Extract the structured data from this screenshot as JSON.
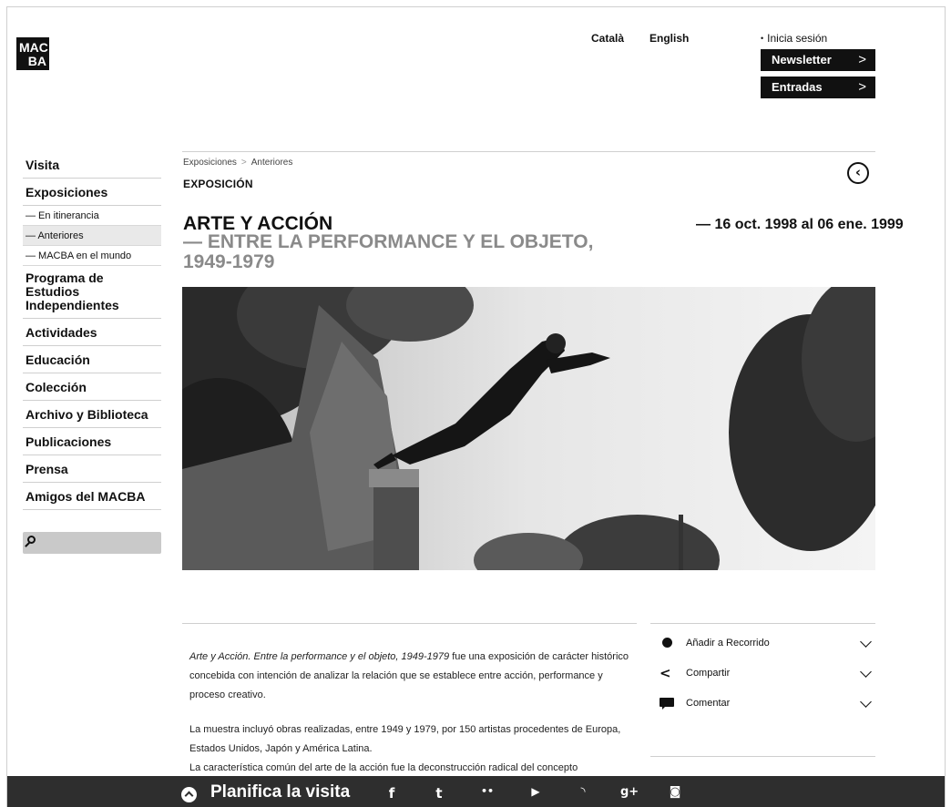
{
  "header": {
    "logo_line1": "MAC",
    "logo_line2": "BA",
    "lang_ca": "Català",
    "lang_en": "English",
    "login": "Inicia sesión",
    "newsletter": "Newsletter",
    "tickets": "Entradas",
    "arrow": ">"
  },
  "sidebar": {
    "visita": "Visita",
    "exposiciones": "Exposiciones",
    "sub": [
      "— En itinerancia",
      "— Anteriores",
      "— MACBA en el mundo"
    ],
    "programa": [
      "Programa de",
      "Estudios",
      "Independientes"
    ],
    "items": [
      "Actividades",
      "Educación",
      "Colección",
      "Archivo y Biblioteca",
      "Publicaciones",
      "Prensa",
      "Amigos del MACBA"
    ]
  },
  "breadcrumb": [
    "Exposiciones",
    "Anteriores"
  ],
  "breadcrumb_sep": ">",
  "kicker": "EXPOSICIÓN",
  "title": "ARTE Y ACCIÓN",
  "subtitle_lines": [
    "— ENTRE LA PERFORMANCE Y EL OBJETO,",
    "1949-1979"
  ],
  "dates": "— 16 oct. 1998 al 06 ene. 1999",
  "body": {
    "p1_italic": "Arte y Acción. Entre la performance y el objeto, 1949-1979",
    "p1_rest": " fue una exposición de carácter histórico concebida con intención de analizar la relación que se establece entre acción, performance y proceso creativo.",
    "p2_line1": "La muestra incluyó obras realizadas, entre 1949 y 1979, por 150 artistas procedentes de Europa, Estados Unidos, Japón y América Latina.",
    "p2_line2": "La característica común del arte de la acción fue la deconstrucción radical del concepto"
  },
  "actions": [
    "Añadir a Recorrido",
    "Compartir",
    "Comentar"
  ],
  "footer": {
    "plan": "Planifica la visita",
    "social_icons": [
      "facebook-icon",
      "twitter-icon",
      "flickr-icon",
      "youtube-icon",
      "rss-icon",
      "google-plus-icon",
      "instagram-icon"
    ]
  },
  "colors": {
    "dark": "#111111",
    "footer": "#2e2e2e",
    "subtitle_gray": "#8a8a8a",
    "sidebar_active": "#e9e9e9"
  }
}
